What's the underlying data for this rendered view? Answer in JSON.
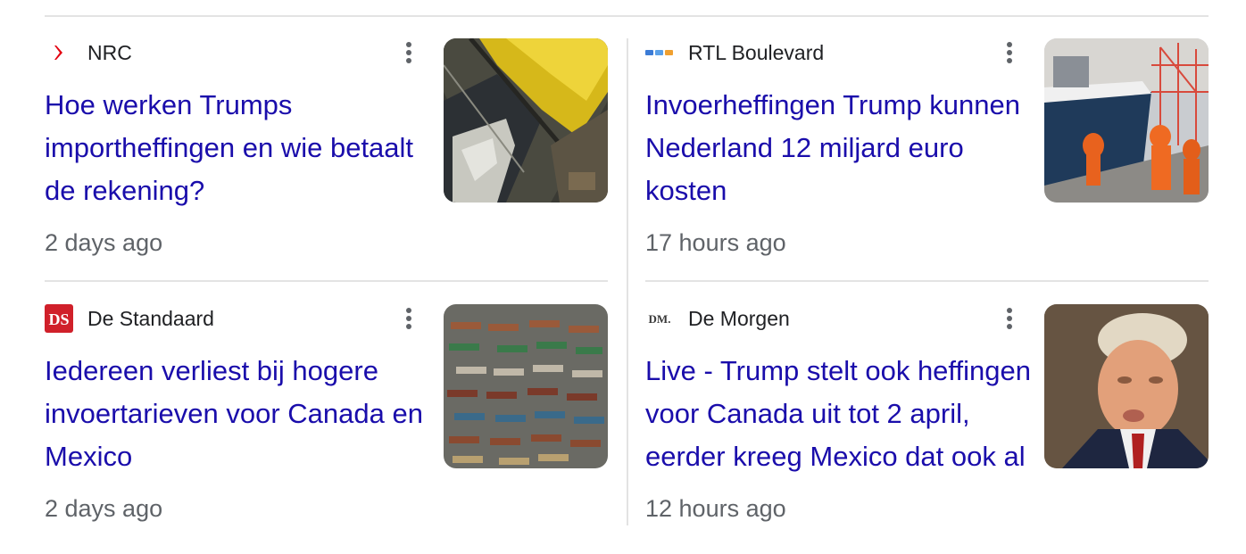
{
  "articles": [
    {
      "source": "NRC",
      "source_logo": "nrc-logo-icon",
      "headline": "Hoe werken Trumps importheffingen en wie betaalt de rekening?",
      "age": "2 days ago",
      "thumbnail": "port-aerial-photo"
    },
    {
      "source": "RTL Boulevard",
      "source_logo": "rtl-boulevard-logo-icon",
      "headline": "Invoerheffingen Trump kunnen Nederland 12 miljard euro kosten",
      "age": "17 hours ago",
      "thumbnail": "ship-dock-workers-photo"
    },
    {
      "source": "De Standaard",
      "source_logo": "de-standaard-logo-icon",
      "logo_text": "DS",
      "headline": "Iedereen verliest bij hogere invoertarieven voor Canada en Mexico",
      "age": "2 days ago",
      "thumbnail": "trucks-aerial-photo"
    },
    {
      "source": "De Morgen",
      "source_logo": "de-morgen-logo-icon",
      "logo_text": "DM.",
      "headline": "Live - Trump stelt ook heffingen voor Canada uit tot 2 april, eerder kreeg Mexico dat ook al",
      "age": "12 hours ago",
      "thumbnail": "trump-portrait-photo"
    }
  ],
  "colors": {
    "headline": "#1a0dab",
    "meta": "#5f6368",
    "source_text": "#202124",
    "divider": "#e3e3e3",
    "nrc_red": "#e3000f",
    "ds_red": "#d0202a"
  },
  "icons": {
    "more_options": "more-vert-icon"
  }
}
